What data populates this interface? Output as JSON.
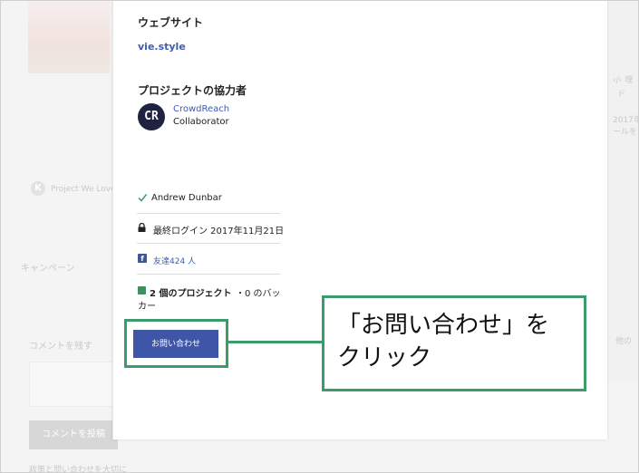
{
  "background": {
    "project_we_love": "Project We Love",
    "campaign_tab": "キャンペーン",
    "comment_heading": "コメントを残す",
    "post_comment_button": "コメントを投稿",
    "footer_text": "政策と問い合わせを大切に",
    "right_fragment_1": "‹/› 埋",
    "right_fragment_2": "ド",
    "right_fragment_3": "2017年",
    "right_fragment_4": "ールを",
    "right_fragment_5": "他の"
  },
  "modal": {
    "website_label": "ウェブサイト",
    "website_link": "vie.style",
    "collaborators_label": "プロジェクトの協力者",
    "collaborator": {
      "initials": "CR",
      "name": "CrowdReach",
      "role": "Collaborator"
    },
    "verified_name": "Andrew Dunbar",
    "last_login": "最終ログイン 2017年11月21日",
    "facebook_icon": "f",
    "friends": "友達424 人",
    "projects_count": "2 個のプロジェクト",
    "projects_suffix": "・0 のバッ",
    "projects_suffix_2": "カー",
    "contact_button": "お問い合わせ"
  },
  "annotation": {
    "line1": "「お問い合わせ」を",
    "line2": "クリック"
  },
  "colors": {
    "accent_link": "#3e5cb3",
    "button_bg": "#3f55a8",
    "callout_green": "#3b9b6a",
    "facebook_blue": "#3b5998"
  },
  "icons": [
    "check-icon",
    "lock-icon",
    "facebook-icon",
    "project-icon",
    "crowdreach-avatar"
  ]
}
